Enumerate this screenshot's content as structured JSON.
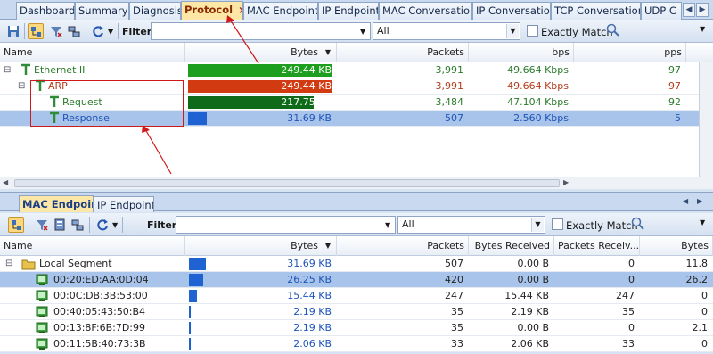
{
  "top_tabs": [
    {
      "label": "Dashboard"
    },
    {
      "label": "Summary"
    },
    {
      "label": "Diagnosis"
    },
    {
      "label": "Protocol"
    },
    {
      "label": "MAC Endpoint"
    },
    {
      "label": "IP Endpoint"
    },
    {
      "label": "MAC Conversation"
    },
    {
      "label": "IP Conversation"
    },
    {
      "label": "TCP Conversation"
    },
    {
      "label": "UDP C"
    }
  ],
  "active_tab_close": "×",
  "toolbar1": {
    "filter_label": "Filter:",
    "filter_value": "",
    "scope_value": "All",
    "exact_match_label": "Exactly Match"
  },
  "protocol_grid": {
    "columns": [
      "Name",
      "Bytes",
      "Packets",
      "bps",
      "pps"
    ],
    "sort_arrow": "▼",
    "rows": [
      {
        "name": "Ethernet II",
        "bytes": "249.44 KB",
        "packets": "3,991",
        "bps": "49.664 Kbps",
        "pps": "97",
        "bar_fraction": 1.0,
        "bar_color": "#1e9e1e",
        "text_color": "green",
        "expander": "⊟"
      },
      {
        "name": "ARP",
        "bytes": "249.44 KB",
        "packets": "3,991",
        "bps": "49.664 Kbps",
        "pps": "97",
        "bar_fraction": 1.0,
        "bar_color": "#d23a12",
        "text_color": "red",
        "expander": "⊟"
      },
      {
        "name": "Request",
        "bytes": "217.75 KB",
        "packets": "3,484",
        "bps": "47.104 Kbps",
        "pps": "92",
        "bar_fraction": 0.873,
        "bar_color": "#0f6b1a",
        "text_color": "green",
        "expander": ""
      },
      {
        "name": "Response",
        "bytes": "31.69 KB",
        "packets": "507",
        "bps": "2.560 Kbps",
        "pps": "5",
        "bar_fraction": 0.127,
        "bar_color": "#1f62d2",
        "text_color": "blue",
        "expander": ""
      }
    ]
  },
  "lower_panel": {
    "tabs": [
      {
        "label": "MAC Endpoint"
      },
      {
        "label": "IP Endpoint"
      }
    ],
    "filter_label": "Filter:",
    "filter_value": "",
    "scope_value": "All",
    "exact_match_label": "Exactly Match"
  },
  "mac_grid": {
    "columns": [
      "Name",
      "Bytes",
      "Packets",
      "Bytes Received",
      "Packets Receiv...",
      "Bytes"
    ],
    "sort_arrow": "▼",
    "rows": [
      {
        "name": "Local Segment",
        "bytes": "31.69 KB",
        "packets": "507",
        "bytes_received": "0.00 B",
        "packets_received": "0",
        "bytes_last": "11.8",
        "bar_fraction": 1.0,
        "expander": "⊟"
      },
      {
        "name": "00:20:ED:AA:0D:04",
        "bytes": "26.25 KB",
        "packets": "420",
        "bytes_received": "0.00 B",
        "packets_received": "0",
        "bytes_last": "26.2",
        "bar_fraction": 0.828,
        "expander": ""
      },
      {
        "name": "00:0C:DB:3B:53:00",
        "bytes": "15.44 KB",
        "packets": "247",
        "bytes_received": "15.44 KB",
        "packets_received": "247",
        "bytes_last": "0",
        "bar_fraction": 0.487,
        "expander": ""
      },
      {
        "name": "00:40:05:43:50:B4",
        "bytes": "2.19 KB",
        "packets": "35",
        "bytes_received": "2.19 KB",
        "packets_received": "35",
        "bytes_last": "0",
        "bar_fraction": 0.069,
        "expander": ""
      },
      {
        "name": "00:13:8F:6B:7D:99",
        "bytes": "2.19 KB",
        "packets": "35",
        "bytes_received": "0.00 B",
        "packets_received": "0",
        "bytes_last": "2.1",
        "bar_fraction": 0.069,
        "expander": ""
      },
      {
        "name": "00:11:5B:40:73:3B",
        "bytes": "2.06 KB",
        "packets": "33",
        "bytes_received": "2.06 KB",
        "packets_received": "33",
        "bytes_last": "0",
        "bar_fraction": 0.065,
        "expander": ""
      }
    ]
  },
  "colors": {
    "annotation_red": "#d01818",
    "selection": "#a9c4ea"
  }
}
